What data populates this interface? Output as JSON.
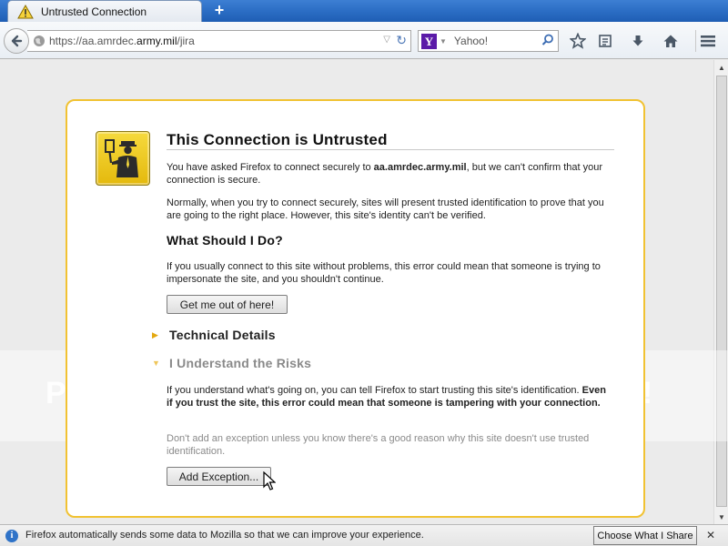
{
  "tab": {
    "title": "Untrusted Connection",
    "new_tab": "+"
  },
  "navbar": {
    "url_prefix": "https://aa.amrdec.",
    "url_domain": "army.mil",
    "url_suffix": "/jira",
    "search_engine": "Y",
    "search_placeholder": "Yahoo!"
  },
  "error_page": {
    "title": "This Connection is Untrusted",
    "intro_before": "You have asked Firefox to connect securely to ",
    "intro_host": "aa.amrdec.army.mil",
    "intro_after": ", but we can't confirm that your connection is secure.",
    "normally": "Normally, when you try to connect securely, sites will present trusted identification to prove that you are going to the right place. However, this site's identity can't be verified.",
    "what_heading": "What Should I Do?",
    "what_text": "If you usually connect to this site without problems, this error could mean that someone is trying to impersonate the site, and you shouldn't continue.",
    "get_out_button": "Get me out of here!",
    "technical_details": "Technical Details",
    "understand_risks": "I Understand the Risks",
    "risks_text": "If you understand what's going on, you can tell Firefox to start trusting this site's identification. ",
    "risks_bold": "Even if you trust the site, this error could mean that someone is tampering with your connection.",
    "exception_note": "Don't add an exception unless you know there's a good reason why this site doesn't use trusted identification.",
    "add_exception_button": "Add Exception..."
  },
  "watermark": {
    "left": "P",
    "right": "ss!"
  },
  "statusbar": {
    "message": "Firefox automatically sends some data to Mozilla so that we can improve your experience.",
    "choose_button": "Choose What I Share",
    "close": "✕"
  },
  "colors": {
    "tabstrip": "#2a6cc3",
    "box_border": "#f1c232",
    "icon_yellow": "#e4b90d",
    "yahoo_purple": "#5b1aa8"
  }
}
